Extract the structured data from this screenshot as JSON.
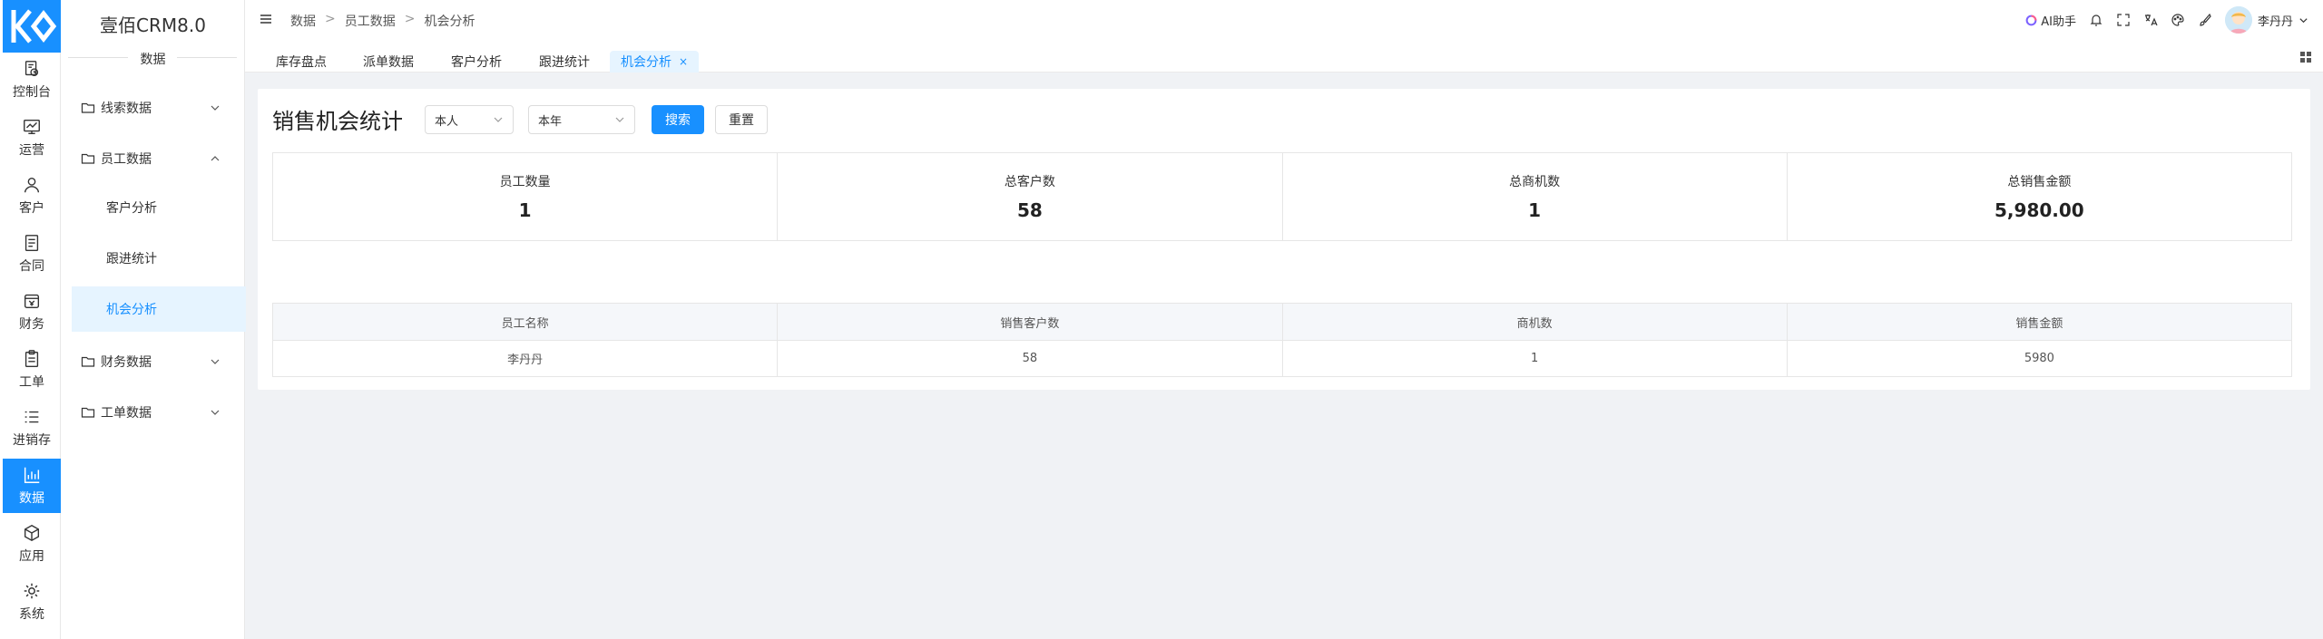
{
  "app": {
    "title": "壹佰CRM8.0",
    "section": "数据"
  },
  "rail": [
    {
      "id": "dashboard",
      "label": "控制台",
      "icon": "dashboard-icon"
    },
    {
      "id": "operations",
      "label": "运营",
      "icon": "monitor-chart-icon"
    },
    {
      "id": "customers",
      "label": "客户",
      "icon": "user-icon"
    },
    {
      "id": "contracts",
      "label": "合同",
      "icon": "document-icon"
    },
    {
      "id": "finance",
      "label": "财务",
      "icon": "wallet-icon"
    },
    {
      "id": "workorders",
      "label": "工单",
      "icon": "clipboard-icon"
    },
    {
      "id": "inventory",
      "label": "进销存",
      "icon": "list-icon"
    },
    {
      "id": "data",
      "label": "数据",
      "icon": "bar-chart-icon",
      "active": true
    },
    {
      "id": "apps",
      "label": "应用",
      "icon": "cube-icon"
    },
    {
      "id": "system",
      "label": "系统",
      "icon": "settings-icon"
    }
  ],
  "submenu": {
    "groups": [
      {
        "label": "线索数据",
        "expanded": false
      },
      {
        "label": "员工数据",
        "expanded": true
      },
      {
        "label": "财务数据",
        "expanded": false
      },
      {
        "label": "工单数据",
        "expanded": false
      }
    ],
    "items": [
      {
        "label": "客户分析"
      },
      {
        "label": "跟进统计"
      },
      {
        "label": "机会分析",
        "active": true
      }
    ]
  },
  "breadcrumb": [
    "数据",
    "员工数据",
    "机会分析"
  ],
  "breadcrumb_sep": ">",
  "topbar": {
    "ai_label": "AI助手",
    "user_name": "李丹丹"
  },
  "tabs": [
    {
      "label": "库存盘点"
    },
    {
      "label": "派单数据"
    },
    {
      "label": "客户分析"
    },
    {
      "label": "跟进统计"
    },
    {
      "label": "机会分析",
      "active": true,
      "close": "×"
    }
  ],
  "page": {
    "title": "销售机会统计",
    "filter_owner": "本人",
    "filter_period": "本年",
    "search_label": "搜索",
    "reset_label": "重置"
  },
  "stats": [
    {
      "label": "员工数量",
      "value": "1"
    },
    {
      "label": "总客户数",
      "value": "58"
    },
    {
      "label": "总商机数",
      "value": "1"
    },
    {
      "label": "总销售金额",
      "value": "5,980.00"
    }
  ],
  "table": {
    "headers": [
      "员工名称",
      "销售客户数",
      "商机数",
      "销售金额"
    ],
    "rows": [
      [
        "李丹丹",
        "58",
        "1",
        "5980"
      ]
    ]
  },
  "colors": {
    "primary": "#1890ff",
    "active_bg": "#e6f4ff",
    "page_bg": "#f0f2f5"
  }
}
